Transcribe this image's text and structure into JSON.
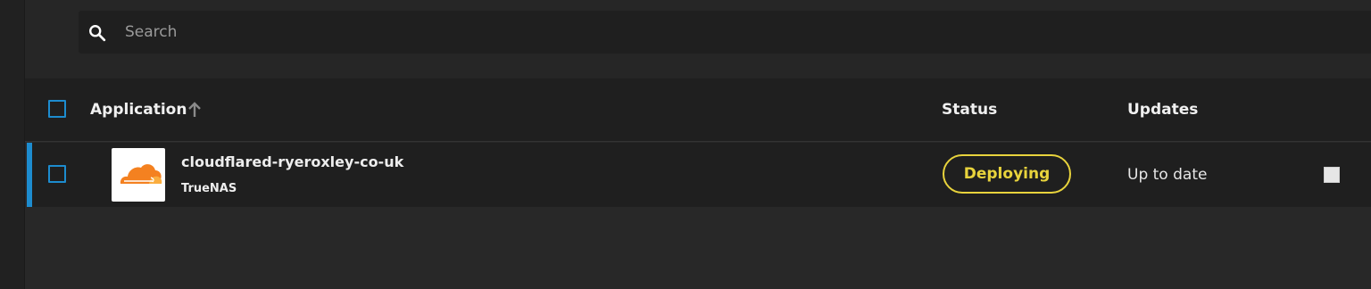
{
  "search": {
    "placeholder": "Search",
    "value": ""
  },
  "table": {
    "headers": {
      "application": "Application",
      "status": "Status",
      "updates": "Updates"
    },
    "sort": {
      "column": "application",
      "direction": "ascending",
      "icon": "arrow-up-icon"
    },
    "rows": [
      {
        "name": "cloudflared-ryeroxley-co-uk",
        "catalog": "TrueNAS",
        "icon": "cloudflare-logo",
        "status": "Deploying",
        "updates": "Up to date",
        "selected": false
      }
    ]
  },
  "colors": {
    "accent": "#1d8ccf",
    "status_deploying": "#e8d33c",
    "cloudflare_orange": "#f48120",
    "background": "#282828"
  }
}
